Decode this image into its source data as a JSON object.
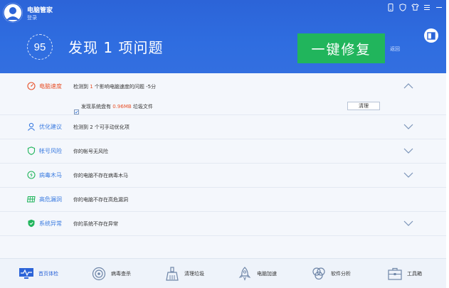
{
  "header": {
    "app_name": "电脑管家",
    "login_text": "登录",
    "score": "95",
    "headline": "发现 1 项问题",
    "fix_button": "一键修复",
    "back_text": "返回",
    "colors": {
      "header_bg": "#2f6de0",
      "fix_button": "#21b55c"
    },
    "top_icons": [
      "phone-icon",
      "shield-icon",
      "shirt-icon",
      "menu-icon",
      "minimize-icon"
    ]
  },
  "results": [
    {
      "icon": "speedometer-icon",
      "name": "电脑速度",
      "status": "alert",
      "desc_parts": [
        "检测到 ",
        "1",
        " 个影响电脑速度的问题  -5分"
      ],
      "expanded": true,
      "sub": {
        "text_parts": [
          "发现系统盘有 ",
          "0.96MB",
          " 垃圾文件"
        ],
        "button": "清理"
      }
    },
    {
      "icon": "person-icon",
      "name": "优化建议",
      "status": "info",
      "desc": "检测到 2 个可手动优化项",
      "expanded": false
    },
    {
      "icon": "shield-icon",
      "name": "帐号风险",
      "status": "ok",
      "desc": "你的帐号无风险",
      "expanded": false
    },
    {
      "icon": "virus-scan-icon",
      "name": "病毒木马",
      "status": "ok",
      "desc": "你的电脑不存在病毒木马",
      "expanded": false
    },
    {
      "icon": "grid-patch-icon",
      "name": "高危漏洞",
      "status": "ok",
      "desc": "你的电脑不存在高危漏洞",
      "expanded": false
    },
    {
      "icon": "system-shield-icon",
      "name": "系统异常",
      "status": "ok",
      "desc": "你的系统不存在异常",
      "expanded": false
    }
  ],
  "nav": [
    {
      "icon": "monitor-check-icon",
      "label": "首页体检",
      "active": true
    },
    {
      "icon": "virus-scan-icon",
      "label": "病毒查杀",
      "active": false
    },
    {
      "icon": "broom-icon",
      "label": "清理垃圾",
      "active": false
    },
    {
      "icon": "rocket-icon",
      "label": "电脑加速",
      "active": false
    },
    {
      "icon": "software-icon",
      "label": "软件分析",
      "active": false
    },
    {
      "icon": "toolbox-icon",
      "label": "工具箱",
      "active": false
    }
  ]
}
